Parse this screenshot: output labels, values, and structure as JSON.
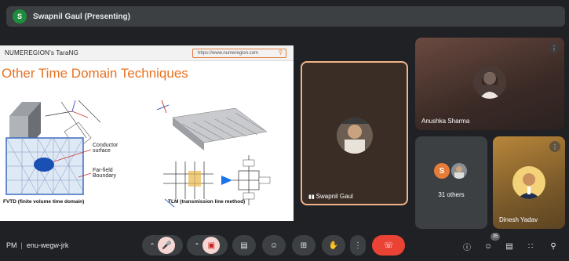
{
  "presenter": {
    "initial": "S",
    "label": "Swapnil Gaul (Presenting)"
  },
  "slide": {
    "brand": "NUMEREGION's TaraNG",
    "url": "https://www.numeregion.com",
    "title": "Other Time Domain Techniques",
    "labels": {
      "conductor": "Conductor surface",
      "far_field": "Far-field Boundary",
      "fvtd_caption": "FVTD (finite volume time domain)",
      "tlm_caption": "TLM (transmission line method)"
    }
  },
  "participants": [
    {
      "name": "Swapnil Gaul"
    },
    {
      "name": "Anushka Sharma"
    },
    {
      "name": "Dinesh Yadav"
    }
  ],
  "others": {
    "initial": "S",
    "label": "31 others"
  },
  "meeting": {
    "time_fragment": "PM",
    "code": "enu-wegw-jrk"
  },
  "participant_count": "35",
  "colors": {
    "accent_orange": "#e8711f",
    "end_call": "#ea4335",
    "bar": "#3c4043"
  },
  "icons": {
    "mic": "mic-off-icon",
    "camera": "camera-off-icon",
    "captions": "captions-icon",
    "emoji": "emoji-icon",
    "present": "present-icon",
    "hand": "raise-hand-icon",
    "more": "more-vert-icon",
    "end": "call-end-icon",
    "info": "info-icon",
    "people": "people-icon",
    "chat": "chat-icon",
    "activities": "activities-icon",
    "lock": "host-controls-icon"
  }
}
